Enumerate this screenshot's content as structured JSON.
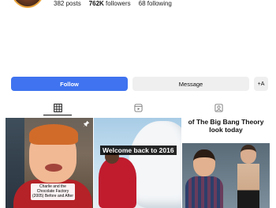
{
  "profile": {
    "stats": {
      "posts": "382 posts",
      "followers_num": "762K",
      "followers_label": " followers",
      "following": "68 following"
    }
  },
  "actions": {
    "follow_label": "Follow",
    "message_label": "Message",
    "suggest_label": "+A"
  },
  "tabs": [
    {
      "name": "posts",
      "icon": "grid-icon",
      "active": true
    },
    {
      "name": "reels",
      "icon": "reels-icon",
      "active": false
    },
    {
      "name": "tagged",
      "icon": "tagged-icon",
      "active": false
    }
  ],
  "grid": [
    {
      "caption": "Charlie and the Chocolate Factory (2005) Before and After",
      "pinned": true
    },
    {
      "caption": "Welcome back to 2016"
    },
    {
      "caption": "of The Big Bang Theory look today"
    }
  ],
  "colors": {
    "follow_bg": "#3f73ef",
    "button_bg": "#efefef"
  }
}
